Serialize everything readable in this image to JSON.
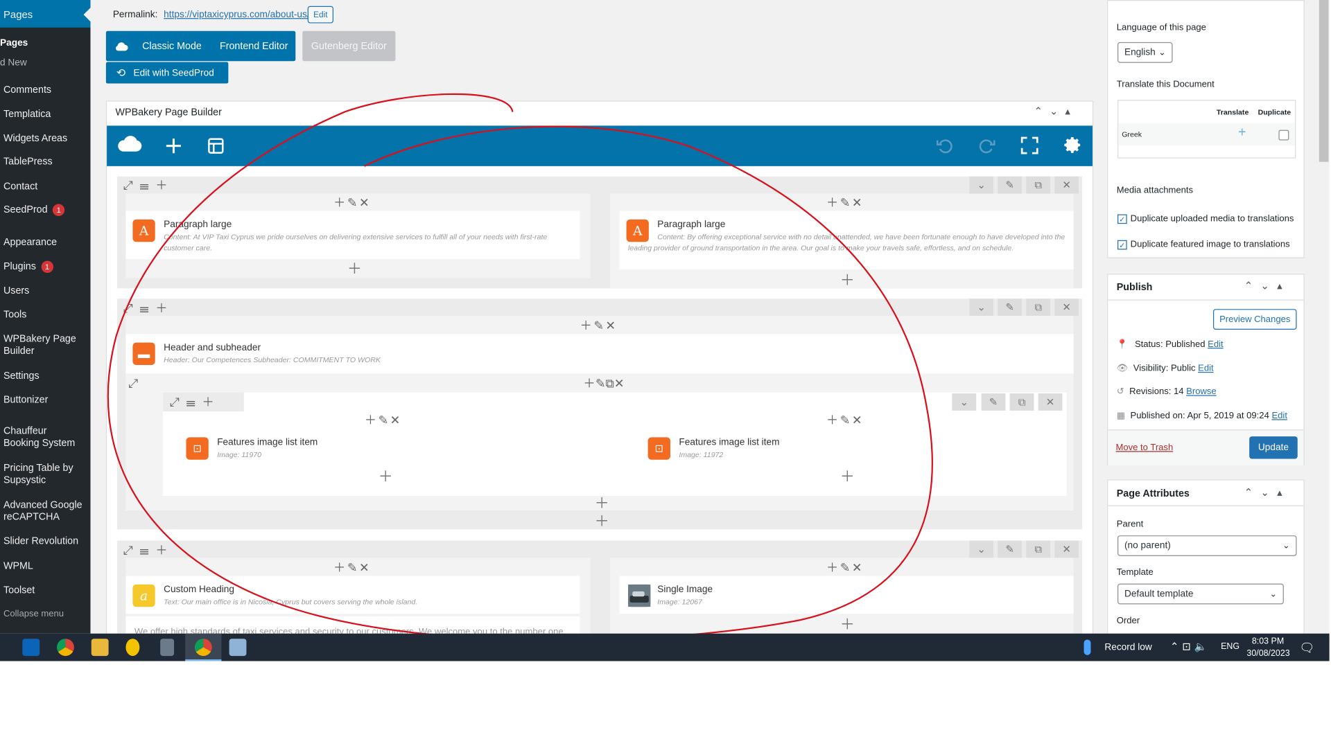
{
  "sidebar": {
    "current": "Pages",
    "sub_items": [
      "Pages",
      "d New"
    ],
    "items": [
      {
        "label": "Comments"
      },
      {
        "label": "Templatica"
      },
      {
        "label": "Widgets Areas"
      },
      {
        "label": "TablePress"
      },
      {
        "label": "Contact"
      },
      {
        "label": "SeedProd",
        "badge": "1"
      },
      {
        "label": "Appearance"
      },
      {
        "label": "Plugins",
        "badge": "1"
      },
      {
        "label": "Users"
      },
      {
        "label": "Tools"
      },
      {
        "label": "WPBakery Page\nBuilder"
      },
      {
        "label": "Settings"
      },
      {
        "label": "Buttonizer"
      },
      {
        "label": "Chauffeur\nBooking System"
      },
      {
        "label": "Pricing Table by\nSupsystic"
      },
      {
        "label": "Advanced Google\nreCAPTCHA"
      },
      {
        "label": "Slider Revolution"
      },
      {
        "label": "WPML"
      },
      {
        "label": "Toolset"
      },
      {
        "label": "Collapse menu"
      }
    ]
  },
  "permalink": {
    "label": "Permalink:",
    "url": "https://viptaxicyprus.com/about-us/",
    "edit": "Edit"
  },
  "mode_buttons": {
    "classic": "Classic Mode",
    "frontend": "Frontend Editor",
    "gutenberg": "Gutenberg Editor",
    "seedprod": "Edit with SeedProd"
  },
  "builder": {
    "title": "WPBakery Page Builder",
    "rows": [
      {
        "cols": [
          {
            "title": "Paragraph large",
            "sub": "Content: At VIP Taxi Cyprus we pride ourselves on delivering extensive services to fulfill all of your needs with first-rate customer care."
          },
          {
            "title": "Paragraph large",
            "sub": "Content: By offering exceptional service with no detail unattended, we have been fortunate enough to have developed into the leading provider of ground transportation in the area. Our goal is to make your travels safe, effortless, and on schedule."
          }
        ]
      },
      {
        "header": {
          "title": "Header and subheader",
          "sub": "Header: Our Competences  Subheader: COMMITMENT TO WORK"
        },
        "inner": [
          {
            "title": "Features image list item",
            "sub": "Image: 11970"
          },
          {
            "title": "Features image list item",
            "sub": "Image: 11972"
          }
        ]
      },
      {
        "cols": [
          {
            "title": "Custom Heading",
            "sub": "Text: Our main office is in Nicosia, Cyprus but covers serving the whole island."
          },
          {
            "title": "Single Image",
            "sub": "Image: 12067"
          }
        ],
        "partial_text": "We offer high standards of taxi services and security to our customers. We welcome you to the number one"
      }
    ]
  },
  "language": {
    "heading": "Language of this page",
    "selected": "English",
    "translate_heading": "Translate this Document",
    "col_translate": "Translate",
    "col_duplicate": "Duplicate",
    "lang_row": "Greek"
  },
  "media": {
    "heading": "Media attachments",
    "opt1": "Duplicate uploaded media to translations",
    "opt2": "Duplicate featured image to translations"
  },
  "publish": {
    "heading": "Publish",
    "preview": "Preview Changes",
    "status_label": "Status:",
    "status": "Published",
    "visibility_label": "Visibility:",
    "visibility": "Public",
    "revisions_label": "Revisions:",
    "revisions": "14",
    "browse": "Browse",
    "published_label": "Published on:",
    "published": "Apr 5, 2019 at 09:24",
    "edit": "Edit",
    "trash": "Move to Trash",
    "update": "Update"
  },
  "attributes": {
    "heading": "Page Attributes",
    "parent_label": "Parent",
    "parent": "(no parent)",
    "template_label": "Template",
    "template": "Default template",
    "order_label": "Order"
  },
  "taskbar": {
    "weather": "Record low",
    "lang": "ENG",
    "time": "8:03 PM",
    "date": "30/08/2023"
  },
  "colors": {
    "wp_blue": "#0073aa",
    "vc_blue": "#0473aa",
    "orange": "#f26b21",
    "yellow": "#f5c82b",
    "annotation": "#d9101b"
  }
}
